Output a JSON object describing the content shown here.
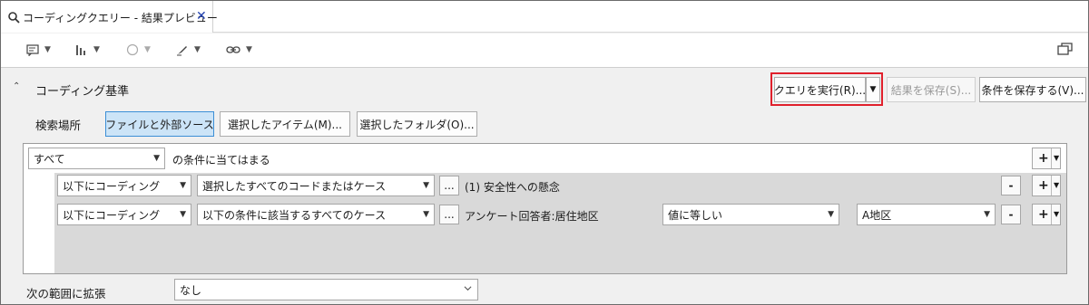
{
  "tab": {
    "title": "コーディングクエリー - 結果プレビュー",
    "close_glyph": "✕"
  },
  "toolbar": {
    "items": [
      "note-icon",
      "chart-icon",
      "circle-icon",
      "brush-icon",
      "link-icon"
    ],
    "restore_icon": "restore-window-icon"
  },
  "section": {
    "title": "コーディング基準",
    "collapse_glyph": "⌃"
  },
  "actions": {
    "run_query": "クエリを実行(R)...",
    "save_results": "結果を保存(S)...",
    "save_criteria": "条件を保存する(V)..."
  },
  "search_location": {
    "label": "検索場所",
    "options": [
      "ファイルと外部ソース",
      "選択したアイテム(M)...",
      "選択したフォルダ(O)..."
    ],
    "selected": "ファイルと外部ソース"
  },
  "criteria": {
    "match_mode": "すべて",
    "match_text": "の条件に当てはまる",
    "rows": [
      {
        "coding": "以下にコーディング",
        "scope": "選択したすべてのコードまたはケース",
        "ellipsis": "...",
        "target": "(1) 安全性への懸念"
      },
      {
        "coding": "以下にコーディング",
        "scope": "以下の条件に該当するすべてのケース",
        "ellipsis": "...",
        "target": "アンケート回答者:居住地区",
        "operator": "値に等しい",
        "value": "A地区"
      }
    ],
    "minus": "-",
    "plus": "+"
  },
  "expand": {
    "label": "次の範囲に拡張",
    "value": "なし"
  },
  "colors": {
    "highlight": "#e0202c",
    "selected_bg": "#cce4f7",
    "panel_gray": "#d9d9d9"
  }
}
